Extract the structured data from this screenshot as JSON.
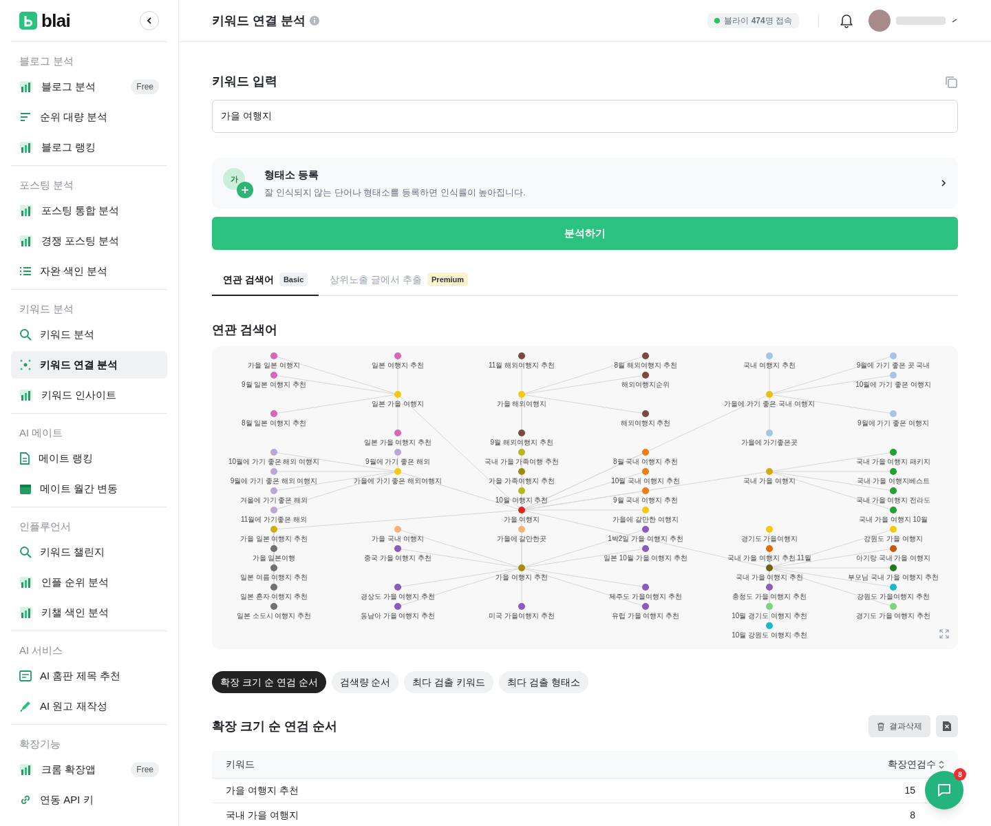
{
  "sidebar": {
    "logo": "blai",
    "sections": [
      {
        "title": "블로그 분석",
        "items": [
          {
            "label": "블로그 분석",
            "badge": "Free",
            "selected": false
          },
          {
            "label": "순위 대량 분석",
            "selected": false
          },
          {
            "label": "블로그 랭킹",
            "selected": false
          }
        ]
      },
      {
        "title": "포스팅 분석",
        "items": [
          {
            "label": "포스팅 통합 분석",
            "selected": false
          },
          {
            "label": "경쟁 포스팅 분석",
            "selected": false
          },
          {
            "label": "자완 색인 분석",
            "selected": false
          }
        ]
      },
      {
        "title": "키워드 분석",
        "items": [
          {
            "label": "키워드 분석",
            "selected": false
          },
          {
            "label": "키워드 연결 분석",
            "selected": true
          },
          {
            "label": "키워드 인사이트",
            "selected": false
          }
        ]
      },
      {
        "title": "AI 메이트",
        "items": [
          {
            "label": "메이트 랭킹",
            "selected": false
          },
          {
            "label": "메이트 월간 변동",
            "selected": false
          }
        ]
      },
      {
        "title": "인플루언서",
        "items": [
          {
            "label": "키워드 챌린지",
            "selected": false
          },
          {
            "label": "인플 순위 분석",
            "selected": false
          },
          {
            "label": "키챌 색인 분석",
            "selected": false
          }
        ]
      },
      {
        "title": "AI 서비스",
        "items": [
          {
            "label": "AI 홈판 제목 추천",
            "selected": false
          },
          {
            "label": "AI 원고 재작성",
            "selected": false
          }
        ]
      },
      {
        "title": "확장기능",
        "items": [
          {
            "label": "크롬 확장앱",
            "badge": "Free",
            "selected": false
          },
          {
            "label": "연동 API 키",
            "selected": false
          }
        ]
      }
    ]
  },
  "header": {
    "title": "키워드 연결 분석",
    "online": "블라이 **474**명 접속"
  },
  "keyword_input": {
    "title": "키워드 입력",
    "value": "가을 여행지"
  },
  "morpheme_card": {
    "icon_text": "가",
    "title": "형태소 등록",
    "description": "잘 인식되지 않는 단어나 형태소를 등록하면 인식률이 높아집니다."
  },
  "analyze_button": "분석하기",
  "tabs": [
    {
      "label": "연관 검색어",
      "badge": "Basic",
      "kind": "basic",
      "selected": true
    },
    {
      "label": "상위노출 글에서 추출",
      "badge": "Premium",
      "kind": "premium",
      "selected": false
    }
  ],
  "related": {
    "title": "연관 검색어",
    "network_graph": {
      "root": {
        "label": "가을 여행지",
        "color": "#e0261f",
        "children": [
          {
            "label": "일본 가을 여행지",
            "color": "#f5c90f",
            "children": [
              {
                "label": "가을 일본 여행지",
                "color": "#d966b8"
              },
              {
                "label": "일본 여행지 추천",
                "color": "#d966b8"
              },
              {
                "label": "9월 일본 여행지 추천",
                "color": "#d966b8"
              },
              {
                "label": "8월 일본 여행지 추천",
                "color": "#d966b8"
              },
              {
                "label": "일본 가을 여행지 추천",
                "color": "#d966b8"
              }
            ]
          },
          {
            "label": "가을 해외여행지",
            "color": "#f5c90f",
            "children": [
              {
                "label": "11월 해외여행지 추천",
                "color": "#7b4a3e"
              },
              {
                "label": "8월 해외여행지 추천",
                "color": "#7b4a3e"
              },
              {
                "label": "해외여행지순위",
                "color": "#7b4a3e"
              },
              {
                "label": "해외여행지 추천",
                "color": "#7b4a3e"
              },
              {
                "label": "9월 해외여행지 추천",
                "color": "#7b4a3e"
              }
            ]
          },
          {
            "label": "가을에 가기 좋은 국내 여행지",
            "color": "#e8c012",
            "children": [
              {
                "label": "국내 여행지 추천",
                "color": "#a9c3e6"
              },
              {
                "label": "9월에 가기 좋은 곳 국내",
                "color": "#a9c3e6"
              },
              {
                "label": "10월에 가기 좋은 여행지",
                "color": "#a9c3e6"
              },
              {
                "label": "9월에 가기 좋은 여행지",
                "color": "#a9c3e6"
              },
              {
                "label": "가을에 가기좋은곳",
                "color": "#a9c3e6"
              }
            ]
          },
          {
            "label": "가을에 가기 좋은 해외여행지",
            "color": "#f5c90f",
            "children": [
              {
                "label": "10월에 가기 좋은 해외 여행지",
                "color": "#b9a8d6"
              },
              {
                "label": "9월에 가기 좋은 해외",
                "color": "#b9a8d6"
              },
              {
                "label": "9월에 가기 좋은 해외 여행지",
                "color": "#b9a8d6"
              },
              {
                "label": "겨울에 가기 좋은 해외",
                "color": "#b9a8d6"
              },
              {
                "label": "11월에 가기좋은 해외",
                "color": "#b9a8d6"
              }
            ]
          },
          {
            "label": "가을 가족여행지 추천",
            "color": "#a08a0c",
            "children": [
              {
                "label": "국내 가을 가족여행 추천",
                "color": "#b5b81e"
              },
              {
                "label": "10월 여행지 추천",
                "color": "#b5b81e"
              }
            ]
          },
          {
            "label": "8월 국내 여행지 추천",
            "color": "#f07c12"
          },
          {
            "label": "10월 국내 여행지 추천",
            "color": "#f07c12"
          },
          {
            "label": "9월 국내 여행지 추천",
            "color": "#f07c12"
          },
          {
            "label": "가을에 갈만한 여행지",
            "color": "#f5c90f"
          },
          {
            "label": "국내 가을 여행지",
            "color": "#d4a90f",
            "children": [
              {
                "label": "국내 가을 여행지 패키지",
                "color": "#22a12f"
              },
              {
                "label": "국내 가을 여행지베스트",
                "color": "#22a12f"
              },
              {
                "label": "국내 가을 여행지 전라도",
                "color": "#22a12f"
              },
              {
                "label": "국내 가을 여행지 10월",
                "color": "#22a12f"
              }
            ]
          },
          {
            "label": "가을 일본 여행지 추천",
            "color": "#cfac12",
            "children": [
              {
                "label": "가을 일본여행",
                "color": "#707070"
              },
              {
                "label": "일본 여름 여행지 추천",
                "color": "#707070"
              },
              {
                "label": "일본 혼자 여행지 추천",
                "color": "#707070"
              },
              {
                "label": "일본 소도시 여행지 추천",
                "color": "#707070"
              }
            ]
          },
          {
            "label": "가을 여행지 추천",
            "color": "#a58d0e",
            "children": [
              {
                "label": "가을 국내 여행지",
                "color": "#f7b27a"
              },
              {
                "label": "가을에 갈만한곳",
                "color": "#f7b27a"
              },
              {
                "label": "1박2일 가을 여행지 추천",
                "color": "#8a5cbf"
              },
              {
                "label": "중국 가을 여행지 추천",
                "color": "#8a5cbf"
              },
              {
                "label": "일본 10월 가을 여행지 추천",
                "color": "#8a5cbf"
              },
              {
                "label": "경상도 가을 여행지 추천",
                "color": "#8a5cbf"
              },
              {
                "label": "제주도 가을여행지 추천",
                "color": "#8a5cbf"
              },
              {
                "label": "동남아 가을 여행지 추천",
                "color": "#8a5cbf"
              },
              {
                "label": "미국 가을여행지 추천",
                "color": "#8a5cbf"
              },
              {
                "label": "유럽 가을 여행지 추천",
                "color": "#8a5cbf"
              }
            ]
          },
          {
            "label": "국내 가을 여행지 추천",
            "color": "#6e6410",
            "children": [
              {
                "label": "경기도 가을여행지",
                "color": "#f5c90f"
              },
              {
                "label": "강원도 가을 여행지",
                "color": "#f5c90f"
              },
              {
                "label": "국내 가을 여행지 추천 11월",
                "color": "#e56c0b"
              },
              {
                "label": "아기랑 국내 가을 여행지",
                "color": "#c75a0a"
              },
              {
                "label": "부모님 국내 가을 여행지 추천",
                "color": "#1f7a1f"
              },
              {
                "label": "충청도 가을 여행지 추천",
                "color": "#8a5cbf"
              },
              {
                "label": "강원도 가을여행지 추천",
                "color": "#1ab8c9"
              },
              {
                "label": "10월 경기도 여행지 추천",
                "color": "#7fd37a"
              },
              {
                "label": "경기도 가을 여행지 추천",
                "color": "#7fd37a"
              },
              {
                "label": "10월 강원도 여행지 추천",
                "color": "#1ab8c9"
              }
            ]
          }
        ]
      }
    }
  },
  "sort_buttons": [
    {
      "label": "확장 크기 순 연검 순서",
      "selected": true
    },
    {
      "label": "검색량 순서",
      "selected": false
    },
    {
      "label": "최다 검출 키워드",
      "selected": false
    },
    {
      "label": "최다 검출 형태소",
      "selected": false
    }
  ],
  "results": {
    "title": "확장 크기 순 연검 순서",
    "delete_button": "결과삭제",
    "table": {
      "columns": [
        "키워드",
        "확장연검수"
      ],
      "rows": [
        [
          "가을 여행지 추천",
          "15"
        ],
        [
          "국내 가을 여행지",
          "8"
        ]
      ]
    }
  },
  "chat": {
    "badge": "8"
  }
}
